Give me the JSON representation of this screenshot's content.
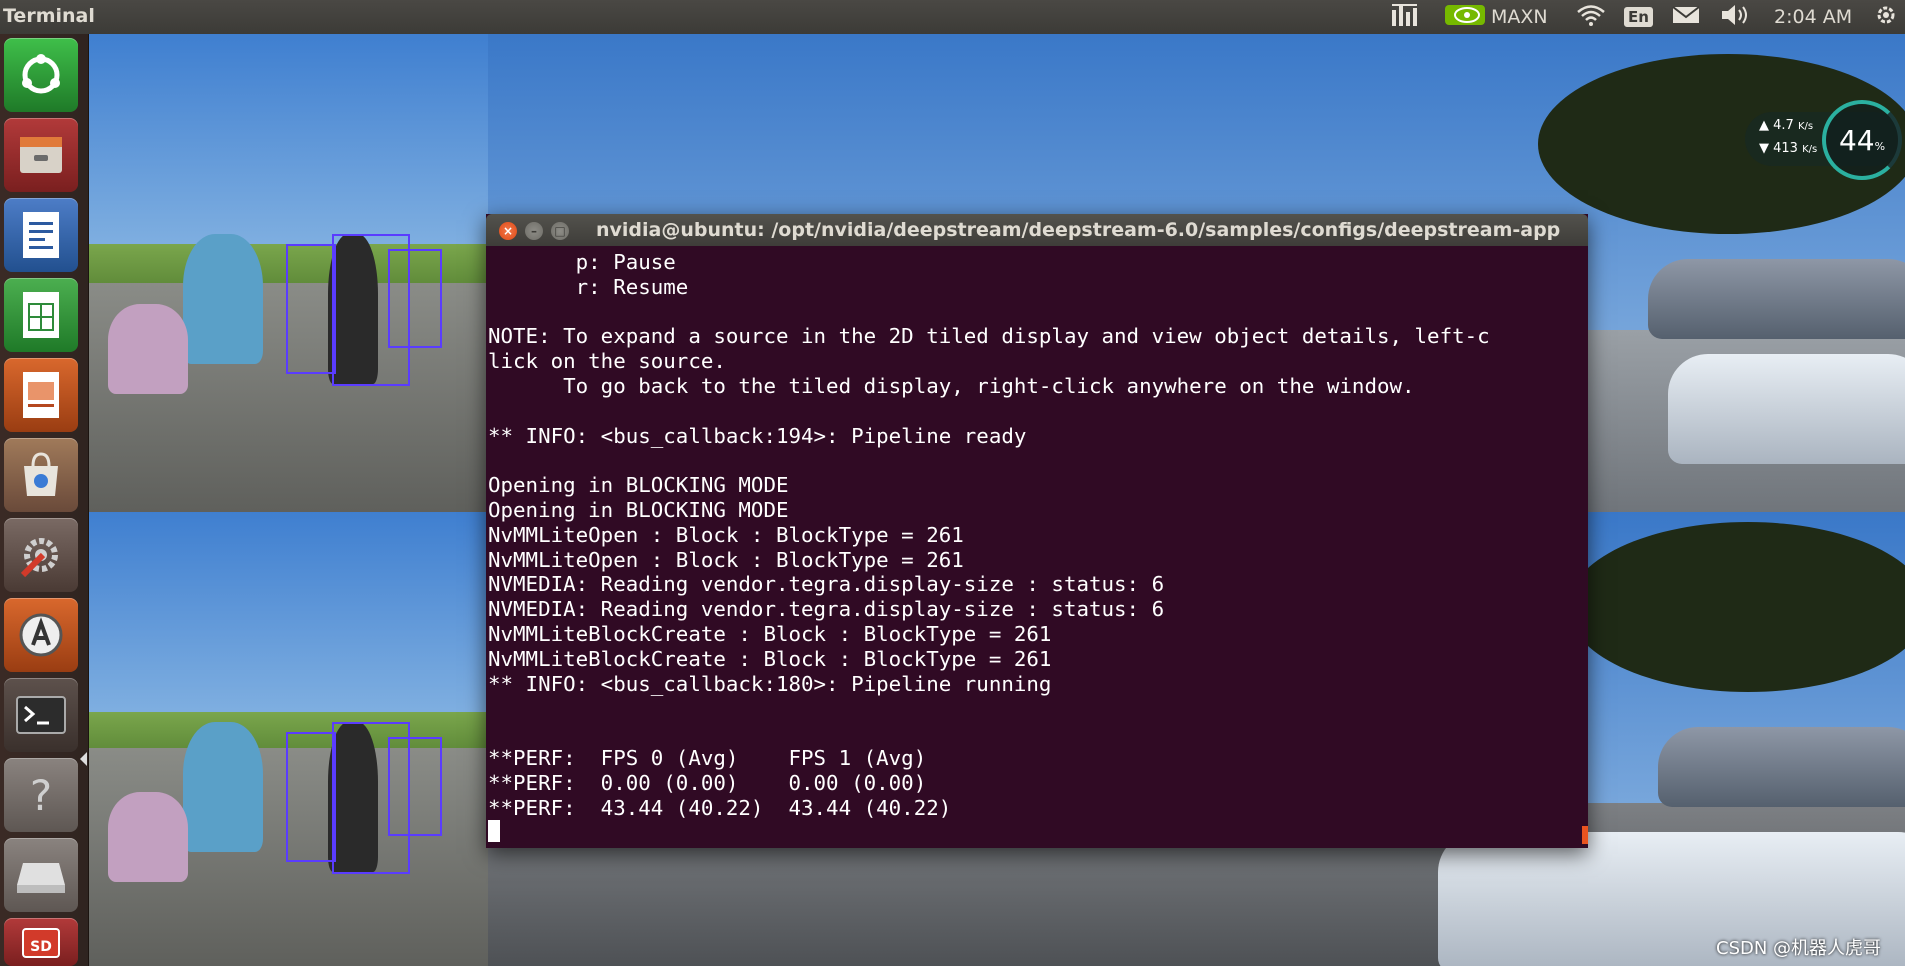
{
  "topbar": {
    "app_title": "Terminal",
    "indicators": [
      {
        "icon": "jtop-stats-icon"
      },
      {
        "icon": "nvidia-icon",
        "label": "MAXN"
      },
      {
        "icon": "wifi-icon"
      },
      {
        "icon": "keyboard-layout-icon",
        "label": "En"
      },
      {
        "icon": "mail-icon"
      },
      {
        "icon": "volume-icon"
      },
      {
        "icon": "gear-icon"
      }
    ],
    "clock": "2:04 AM"
  },
  "launcher": {
    "items": [
      {
        "name": "ubuntu-dash-icon",
        "color": "#2f9c3a"
      },
      {
        "name": "files-icon",
        "color": "#8e2a2a"
      },
      {
        "name": "libreoffice-writer-icon",
        "color": "#2c5aa0"
      },
      {
        "name": "libreoffice-calc-icon",
        "color": "#2e8b3a"
      },
      {
        "name": "libreoffice-impress-icon",
        "color": "#b5471f"
      },
      {
        "name": "software-center-icon",
        "color": "#6a4a3a"
      },
      {
        "name": "system-settings-icon",
        "color": "#5a4a44"
      },
      {
        "name": "software-updater-icon",
        "color": "#b3541e"
      },
      {
        "name": "terminal-icon",
        "color": "#4b3f3a"
      },
      {
        "name": "help-icon",
        "color": "#6e6763"
      },
      {
        "name": "drive-icon",
        "color": "#6e6763"
      },
      {
        "name": "sd-card-icon",
        "color": "#8e2a2a"
      }
    ]
  },
  "net_widget": {
    "up": "4.7",
    "down": "413",
    "unit": "K/s",
    "cpu": "44",
    "cpu_unit": "%"
  },
  "terminal": {
    "title": "nvidia@ubuntu: /opt/nvidia/deepstream/deepstream-6.0/samples/configs/deepstream-app",
    "lines": [
      "       p: Pause",
      "       r: Resume",
      "",
      "NOTE: To expand a source in the 2D tiled display and view object details, left-c",
      "lick on the source.",
      "      To go back to the tiled display, right-click anywhere on the window.",
      "",
      "** INFO: <bus_callback:194>: Pipeline ready",
      "",
      "Opening in BLOCKING MODE",
      "Opening in BLOCKING MODE",
      "NvMMLiteOpen : Block : BlockType = 261",
      "NvMMLiteOpen : Block : BlockType = 261",
      "NVMEDIA: Reading vendor.tegra.display-size : status: 6",
      "NVMEDIA: Reading vendor.tegra.display-size : status: 6",
      "NvMMLiteBlockCreate : Block : BlockType = 261",
      "NvMMLiteBlockCreate : Block : BlockType = 261",
      "** INFO: <bus_callback:180>: Pipeline running",
      "",
      "",
      "**PERF:  FPS 0 (Avg)    FPS 1 (Avg)",
      "**PERF:  0.00 (0.00)    0.00 (0.00)",
      "**PERF:  43.44 (40.22)  43.44 (40.22)"
    ]
  },
  "watermark": "CSDN @机器人虎哥"
}
